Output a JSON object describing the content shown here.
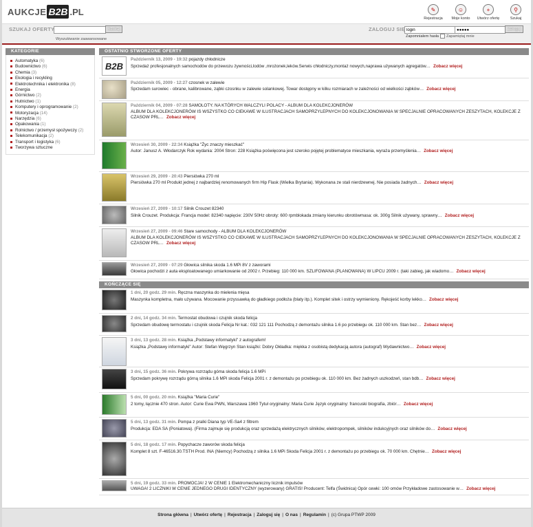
{
  "logo": {
    "left": "AUKCJE",
    "mid": "B2B",
    "right": ".PL"
  },
  "top_icons": [
    {
      "icon": "registration-icon",
      "label": "Rejestracja"
    },
    {
      "icon": "my-account-icon",
      "label": "Moje konto"
    },
    {
      "icon": "create-offer-icon",
      "label": "Utwórz ofertę"
    },
    {
      "icon": "search-icon",
      "label": "Szukaj"
    }
  ],
  "search": {
    "title": "SZUKAJ OFERTY",
    "button": "Szukaj",
    "advanced": "Wyszukiwanie zaawansowane",
    "value": ""
  },
  "login": {
    "title": "ZALOGUJ SIĘ",
    "login_value": "login",
    "password_value": "●●●●●",
    "button": "Zaloguj",
    "forgot": "Zapomniałem hasła",
    "remember": "Zapamiętaj mnie"
  },
  "categories": {
    "title": "KATEGORIE",
    "items": [
      {
        "name": "Automatyka",
        "count": "(6)"
      },
      {
        "name": "Budownictwo",
        "count": "(6)"
      },
      {
        "name": "Chemia",
        "count": "(3)"
      },
      {
        "name": "Ekologia i recykling",
        "count": ""
      },
      {
        "name": "Elektrotechnika i elektronika",
        "count": "(8)"
      },
      {
        "name": "Energia",
        "count": ""
      },
      {
        "name": "Górnictwo",
        "count": "(2)"
      },
      {
        "name": "Hutnictwo",
        "count": "(1)"
      },
      {
        "name": "Komputery i oprogramowanie",
        "count": "(2)"
      },
      {
        "name": "Motoryzacja",
        "count": "(14)"
      },
      {
        "name": "Narzędzia",
        "count": "(6)"
      },
      {
        "name": "Opakowania",
        "count": "(1)"
      },
      {
        "name": "Rolnictwo / przemysł spożywczy",
        "count": "(2)"
      },
      {
        "name": "Telekomunikacja",
        "count": "(2)"
      },
      {
        "name": "Transport i logistyka",
        "count": "(6)"
      },
      {
        "name": "Tworzywa sztuczne",
        "count": ""
      }
    ]
  },
  "more_label": "Zobacz więcej",
  "latest": {
    "title": "OSTATNIO STWORZONE OFERTY",
    "offers": [
      {
        "date": "Październik 13, 2009 - 19:32",
        "title": "pojazdy chłodnicze",
        "desc": "Sprzedaż profesjonalnych samochodów do przewozu żywności,lodów ,mrożonek,leków.Serwis chłodniczy,montaż nowych,naprawa używanych agregatów…",
        "thumb": "b2b-logo-image"
      },
      {
        "date": "Październik 05, 2009 - 12:27",
        "title": "czosnek w zalewie",
        "desc": "Sprzedam surowiec - obrane, kalibrowane, ząbki czosnku w zalewie solankowej. Towar dostępny w kilku rozmiarach w zależności od wielkości ząbków…",
        "thumb": "garlic-image"
      },
      {
        "date": "Październik 04, 2009 - 07:28",
        "title": "SAMOLOTY. NA KTÓRYCH WALCZYLI POLACY - ALBUM DLA KOLEKCJONERÓW",
        "desc": "ALBUM DLA KOLEKCJONERÓW  IS WSZYSTKO CO CIEKAWE W ILUSTRACJACH SAMOPRZYLEPNYCH DO KOLEKCJONOWANIA W SPECJALNIE OPRACOWANYCH ZESZYTACH, KOLEKCJE Z CZASOW PRL…",
        "thumb": "album-samoloty-image"
      },
      {
        "date": "Wrzesień 30, 2009 - 22:34",
        "title": "Książka \"Życ znaczy mieszkać\"",
        "desc": "Autor: Janusz A. Włodarczyk Rok wydania: 2004 Stron: 228   Książka poświęcona jest szeroko pojętej problematyce mieszkania, wyraża przemyślenia…",
        "thumb": "book-image"
      },
      {
        "date": "Wrzesień 29, 2009 - 20:43",
        "title": "Piersiówka 270 ml",
        "desc": " Piersiówka 270 ml Produkt jednej z najbardziej renomowanych firm Hip Flask (Wielka Brytania). Wykonana ze stali nierdzewnej. Nie posiada żadnych…",
        "thumb": "flask-image"
      },
      {
        "date": "Wrzesień 27, 2009 - 10:17",
        "title": "Silnik Crouzet 82340",
        "desc": "Silnik Crouzet. Produkcja: Francja model: 82340 napięcie: 230V 50Hz obroty: 600 rpmblokada zmiany kierunku obrotówmasa: ok. 300g Silnik używany, sprawny…",
        "thumb": "motor-image"
      },
      {
        "date": "Wrzesień 27, 2009 - 09:46",
        "title": "Stare samochody - ALBUM DLA KOLEKCJONERÓW",
        "desc": "ALBUM DLA KOLEKCJONERÓW  IS WSZYSTKO CO CIEKAWE W ILUSTRACJACH SAMOPRZYLEPNYCH DO KOLEKCJONOWANIA W SPECJALNIE OPRACOWANYCH ZESZYTACH, KOLEKCJE Z CZASOW PRL…",
        "thumb": "album-cars-image"
      },
      {
        "date": "Wrzesień 27, 2009 - 07:29",
        "title": "Głowica silnika skoda 1.6 MPi 8V z zaworami",
        "desc": "Głowica pochodzi z auta eksploatowanego umiarkowanie od 2002 r. Przebieg: 110 000 km. SZLIFOWANA (PLANOWANA) W LIPCU 2009 r. (taki zabieg, jak wiadomo…",
        "thumb": "cylinder-head-image"
      }
    ]
  },
  "ending": {
    "title": "KOŃCZĄCE SIĘ",
    "offers": [
      {
        "date": "1 dni, 20 godz. 29 min.",
        "title": "Ręczna maszynka do mielenia mięsa",
        "desc": "Maszynka kompletna, mało używana. Mocowanie przyssawką do gładkiego podłoża (blaty itp.). Komplet sitek i ostrzy wymieniony. Rękojeść korby lekko…",
        "thumb": "meat-grinder-image"
      },
      {
        "date": "2 dni, 14 godz. 34 min.",
        "title": "Termostat obudowa i czujnik skoda felicja",
        "desc": "Sprzedam obudowę termostatu i czujnik skoda Felicja Nr kat.: 032 121 111 Pochodzą z demontażu silnika 1.6 po przebiegu ok. 110 000 km. Stan bez…",
        "thumb": "thermostat-image"
      },
      {
        "date": "3 dni, 13 godz. 28 min.",
        "title": "Książka „Podstawy informatyki\" z autografem!",
        "desc": "Książka „Podstawy informatyki\" Autor: Stefan Węgrzyn Stan książki: Dobry Okładka: miękka z osobistą dedykacją autora (autograf) Wydawnictwo…",
        "thumb": "informatics-book-image"
      },
      {
        "date": "3 dni, 15 godz. 36 min.",
        "title": "Pokrywa rozrządu góma skoda felicja 1.6 MPi",
        "desc": "Sprzedam pokrywę rozrządu górną silnika 1.6 MPi skoda Felicja 2001 r. z demontażu po przebiegu ok. 110 000 km. Bez żadnych uszkodzeń, stan bdb…",
        "thumb": "timing-cover-image"
      },
      {
        "date": "5 dni, 00 godz. 20 min.",
        "title": "Książka \"Maria Curie\"",
        "desc": " 2 tomy, łącznie 470 stron. Autor: Curie Ewa PWN, Warszawa 1960 Tytuł oryginalny: Maria Curie Język oryginalny: francuski biografia, zbiór…",
        "thumb": "curie-book-image"
      },
      {
        "date": "5 dni, 13 godz. 31 min.",
        "title": "Pompa z pralki Diana typ VE-Sa4 z filtrem",
        "desc": "Produkcja: EDA SA (Poniatowa). (Firma zajmuje się produkcją oraz sprzedażą elektrycznych silników, elektropompek, silników indukcyjnych oraz silników do…",
        "thumb": "pump-image"
      },
      {
        "date": "5 dni, 18 godz. 17 min.",
        "title": "Popychacze zaworów skoda felicja",
        "desc": "Komplet 8 szt. F-46516.30.TSTH Prod. INA (Niemcy) Pochodzą z silnika 1.6 MPi Skoda Felicja 2001 r. z demontażu po przebiegu ok. 70 000 km. Chętnie…",
        "thumb": "valve-lifters-image"
      },
      {
        "date": "5 dni, 19 godz. 33 min.",
        "title": "PROMOCJA! 2 W CENIE 1 Elektromechaniczny licznik impulsów",
        "desc": "UWAGA! 2 LICZNIKI W CENIE JEDNEGO DRUGI IDENTYCZNY (wyzerowany) GRATIS! Producent: Telfa (Świdnica) Opór cewki: 100 omów Przykładowe zastosowanie w…",
        "thumb": "counter-image"
      }
    ]
  },
  "footer": {
    "links": [
      "Strona główna",
      "Utwórz ofertę",
      "Rejestracja",
      "Zaloguj się",
      "O nas",
      "Regulamin"
    ],
    "copyright": "(c) Grupa PTWP 2009"
  },
  "colors": {
    "accent": "#b01d1d",
    "bar": "#8a8a8a"
  }
}
